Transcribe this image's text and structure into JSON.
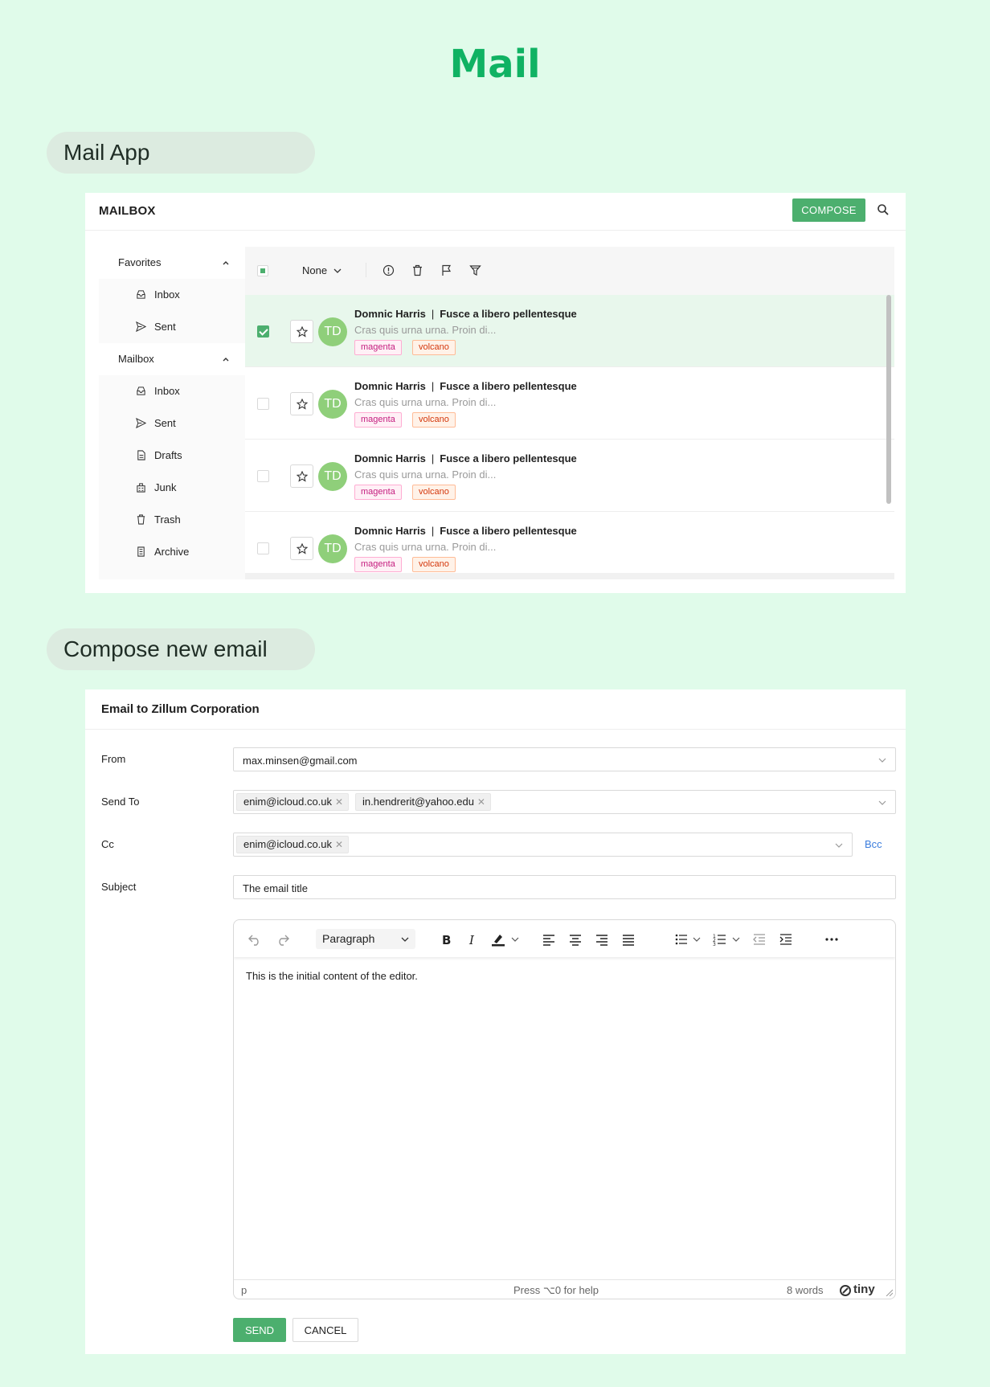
{
  "page": {
    "title": "Mail"
  },
  "sections": {
    "mail_app": "Mail App",
    "compose": "Compose new email"
  },
  "colors": {
    "accent": "#10b263",
    "button": "#4caf6e",
    "background": "#e0fbea",
    "link": "#3b7ddd"
  },
  "mailbox": {
    "title": "MAILBOX",
    "compose_label": "COMPOSE",
    "sidebar": {
      "favorites": {
        "label": "Favorites",
        "items": [
          {
            "label": "Inbox",
            "icon": "inbox-icon"
          },
          {
            "label": "Sent",
            "icon": "send-icon"
          }
        ]
      },
      "mailbox": {
        "label": "Mailbox",
        "items": [
          {
            "label": "Inbox",
            "icon": "inbox-icon"
          },
          {
            "label": "Sent",
            "icon": "send-icon"
          },
          {
            "label": "Drafts",
            "icon": "draft-icon"
          },
          {
            "label": "Junk",
            "icon": "junk-icon"
          },
          {
            "label": "Trash",
            "icon": "trash-icon"
          },
          {
            "label": "Archive",
            "icon": "archive-icon"
          }
        ]
      }
    },
    "toolbar": {
      "filter_value": "None"
    },
    "messages": [
      {
        "sender": "Domnic Harris",
        "separator": "|",
        "subject": "Fusce a libero pellentesque",
        "snippet": "Cras quis urna urna. Proin di...",
        "avatar": "TD",
        "tags": [
          "magenta",
          "volcano"
        ],
        "checked": true
      },
      {
        "sender": "Domnic Harris",
        "separator": "|",
        "subject": "Fusce a libero pellentesque",
        "snippet": "Cras quis urna urna. Proin di...",
        "avatar": "TD",
        "tags": [
          "magenta",
          "volcano"
        ],
        "checked": false
      },
      {
        "sender": "Domnic Harris",
        "separator": "|",
        "subject": "Fusce a libero pellentesque",
        "snippet": "Cras quis urna urna. Proin di...",
        "avatar": "TD",
        "tags": [
          "magenta",
          "volcano"
        ],
        "checked": false
      },
      {
        "sender": "Domnic Harris",
        "separator": "|",
        "subject": "Fusce a libero pellentesque",
        "snippet": "Cras quis urna urna. Proin di...",
        "avatar": "TD",
        "tags": [
          "magenta",
          "volcano"
        ],
        "checked": false
      }
    ]
  },
  "compose": {
    "title": "Email to Zillum Corporation",
    "from": {
      "label": "From",
      "value": "max.minsen@gmail.com"
    },
    "send_to": {
      "label": "Send To",
      "values": [
        "enim@icloud.co.uk",
        "in.hendrerit@yahoo.edu"
      ]
    },
    "cc": {
      "label": "Cc",
      "values": [
        "enim@icloud.co.uk"
      ],
      "bcc_label": "Bcc"
    },
    "subject": {
      "label": "Subject",
      "value": "The email title"
    },
    "editor": {
      "block_format": "Paragraph",
      "content": "This is the initial content of the editor.",
      "status_path": "p",
      "status_help": "Press ⌥0 for help",
      "word_count": "8 words",
      "brand": "tiny"
    },
    "send_label": "SEND",
    "cancel_label": "CANCEL"
  }
}
